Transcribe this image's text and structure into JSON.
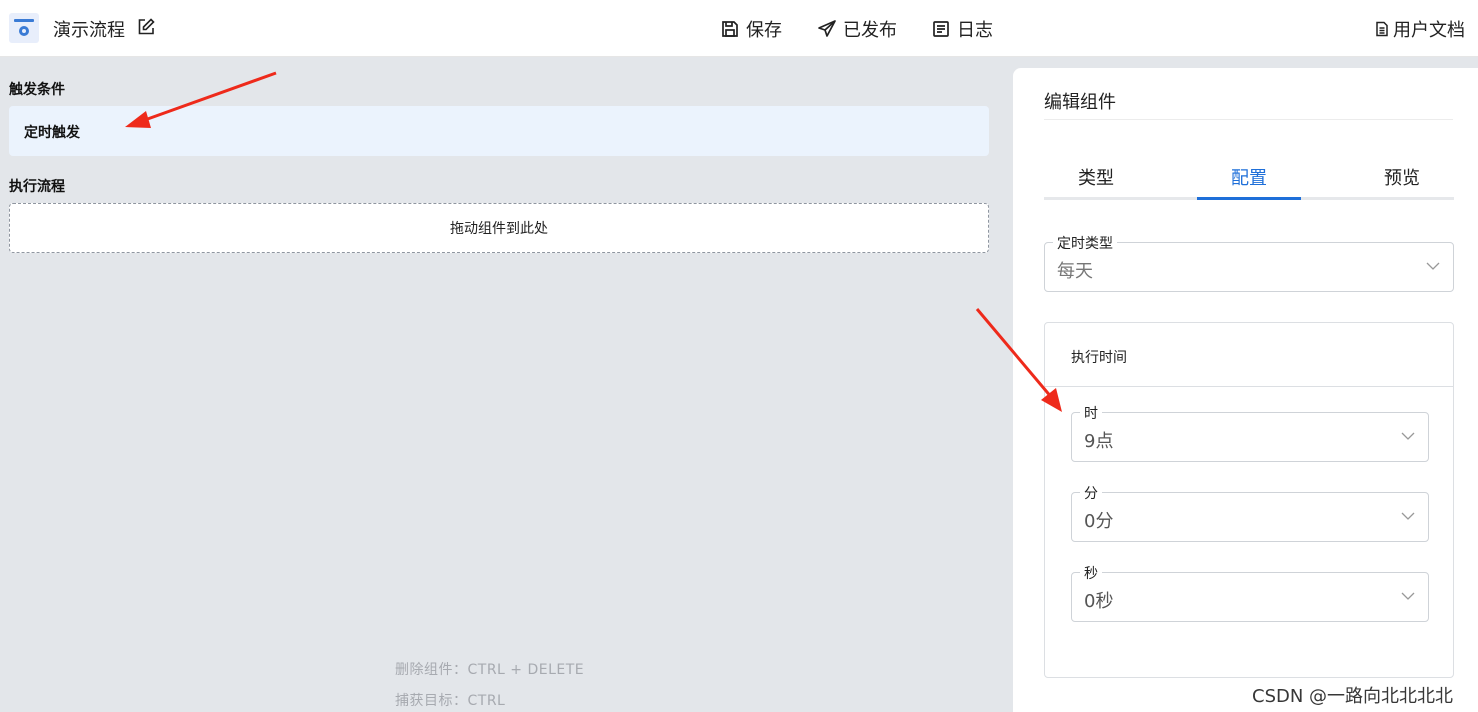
{
  "header": {
    "logo_icon": "workflow-app-icon",
    "title": "演示流程",
    "edit_icon": "edit-icon",
    "save_label": "保存",
    "publish_label": "已发布",
    "log_label": "日志",
    "docs_label": "用户文档"
  },
  "canvas": {
    "trigger_section_label": "触发条件",
    "trigger_item": "定时触发",
    "flow_section_label": "执行流程",
    "drop_zone_text": "拖动组件到此处",
    "hint_delete": "删除组件：CTRL + DELETE",
    "hint_capture": "捕获目标：CTRL"
  },
  "panel": {
    "title": "编辑组件",
    "tabs": [
      {
        "label": "类型",
        "active": false
      },
      {
        "label": "配置",
        "active": true
      },
      {
        "label": "预览",
        "active": false
      }
    ],
    "timer_type": {
      "label": "定时类型",
      "value": "每天"
    },
    "execution_time": {
      "title": "执行时间",
      "hour": {
        "label": "时",
        "value": "9点"
      },
      "minute": {
        "label": "分",
        "value": "0分"
      },
      "second": {
        "label": "秒",
        "value": "0秒"
      }
    }
  },
  "watermark": "CSDN @一路向北北北北",
  "colors": {
    "accent": "#1e6fd9",
    "canvas_bg": "#e3e6ea",
    "trigger_card_bg": "#ebf3fd",
    "arrow": "#ee2a1b"
  }
}
